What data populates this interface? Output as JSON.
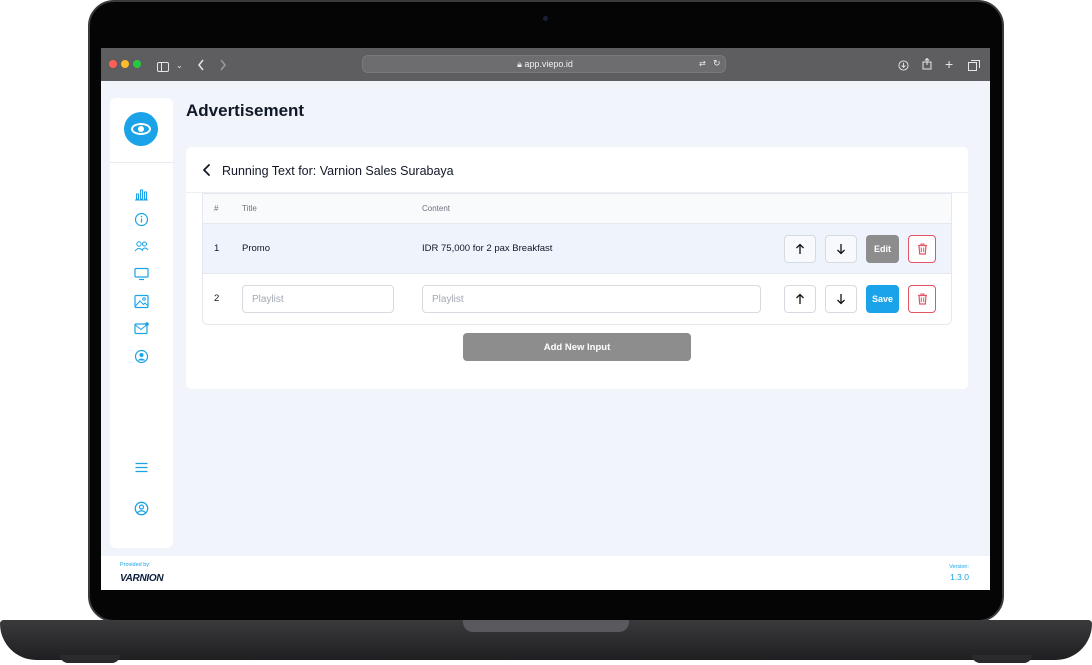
{
  "browser": {
    "url": "app.viepo.id"
  },
  "sidebar": {
    "icons": [
      "bar-chart-icon",
      "info-icon",
      "users-icon",
      "monitor-icon",
      "image-icon",
      "mail-icon",
      "user-circle-icon"
    ],
    "bottom_icons": [
      "menu-icon",
      "account-icon"
    ]
  },
  "page": {
    "title": "Advertisement"
  },
  "card": {
    "title": "Running Text for: Varnion Sales Surabaya"
  },
  "table": {
    "headers": {
      "index": "#",
      "title": "Title",
      "content": "Content"
    },
    "rows": [
      {
        "index": "1",
        "title": "Promo",
        "content": "IDR 75,000 for 2 pax Breakfast",
        "action_label": "Edit"
      },
      {
        "index": "2",
        "title_placeholder": "Playlist",
        "content_placeholder": "Playlist",
        "action_label": "Save"
      }
    ]
  },
  "add_button": "Add New Input",
  "footer": {
    "provided_by": "Provided by:",
    "brand": "VARNION",
    "version_label": "Version:",
    "version_value": "1.3.0"
  },
  "colors": {
    "accent": "#1aa3e8",
    "danger": "#e25563",
    "disabled": "#8d8d8d"
  }
}
